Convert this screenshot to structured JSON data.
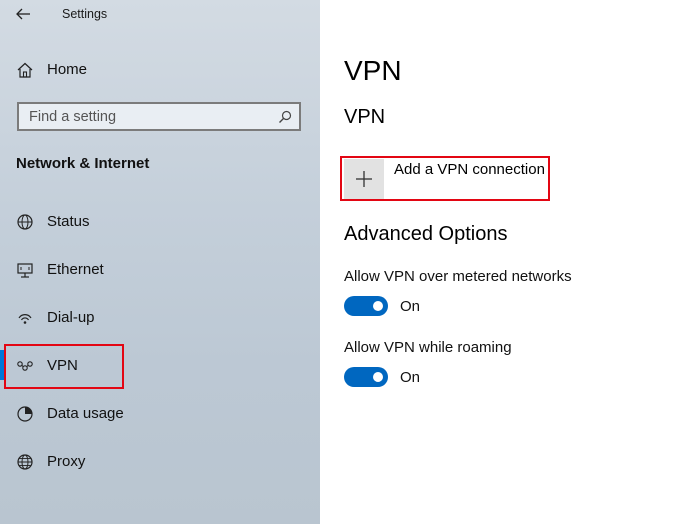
{
  "window": {
    "title": "Settings"
  },
  "sidebar": {
    "home_label": "Home",
    "search": {
      "placeholder": "Find a setting"
    },
    "section_label": "Network & Internet",
    "items": [
      {
        "label": "Status",
        "icon": "status-icon"
      },
      {
        "label": "Ethernet",
        "icon": "ethernet-icon"
      },
      {
        "label": "Dial-up",
        "icon": "dialup-icon"
      },
      {
        "label": "VPN",
        "icon": "vpn-icon",
        "selected": true
      },
      {
        "label": "Data usage",
        "icon": "data-usage-icon"
      },
      {
        "label": "Proxy",
        "icon": "proxy-icon"
      }
    ]
  },
  "main": {
    "title": "VPN",
    "subtitle": "VPN",
    "add_button_label": "Add a VPN connection",
    "advanced_title": "Advanced Options",
    "options": [
      {
        "label": "Allow VPN over metered networks",
        "state": "On",
        "on": true
      },
      {
        "label": "Allow VPN while roaming",
        "state": "On",
        "on": true
      }
    ]
  },
  "colors": {
    "accent": "#0067c0",
    "highlight": "#e30613",
    "selection_marker": "#0078d7"
  }
}
